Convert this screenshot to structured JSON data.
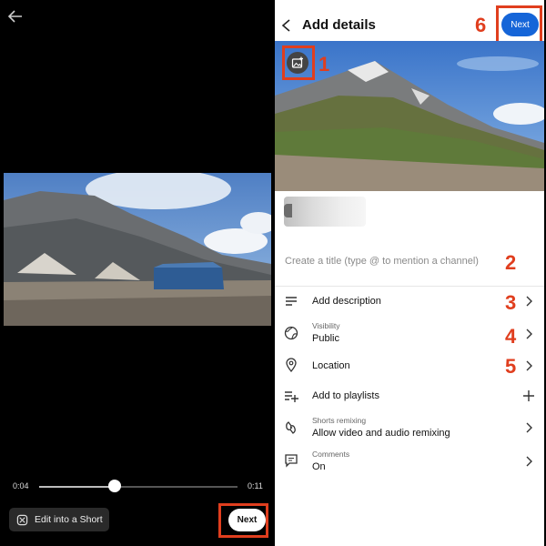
{
  "left_pane": {
    "current_time": "0:04",
    "total_time": "0:11",
    "progress": 0.38,
    "edit_short_label": "Edit into a Short",
    "next_label": "Next"
  },
  "right_pane": {
    "title": "Add details",
    "next_label": "Next",
    "title_placeholder": "Create a title (type @ to mention a channel)",
    "rows": {
      "description": {
        "label": "Add description"
      },
      "visibility": {
        "sublabel": "Visibility",
        "label": "Public"
      },
      "location": {
        "label": "Location"
      },
      "playlists": {
        "label": "Add to playlists"
      },
      "remixing": {
        "sublabel": "Shorts remixing",
        "label": "Allow video and audio remixing"
      },
      "comments": {
        "sublabel": "Comments",
        "label": "On"
      }
    }
  },
  "annotations": [
    "1",
    "2",
    "3",
    "4",
    "5",
    "6"
  ],
  "colors": {
    "annotation_red": "#e03e1e",
    "next_blue": "#1565d8",
    "editor_bg": "#000000"
  },
  "icons": [
    "back-arrow-icon",
    "scissors-short-icon",
    "chevron-left-icon",
    "image-edit-icon",
    "description-lines-icon",
    "globe-icon",
    "location-pin-icon",
    "playlist-add-icon",
    "remix-icon",
    "comment-icon",
    "chevron-right-icon",
    "plus-icon"
  ]
}
